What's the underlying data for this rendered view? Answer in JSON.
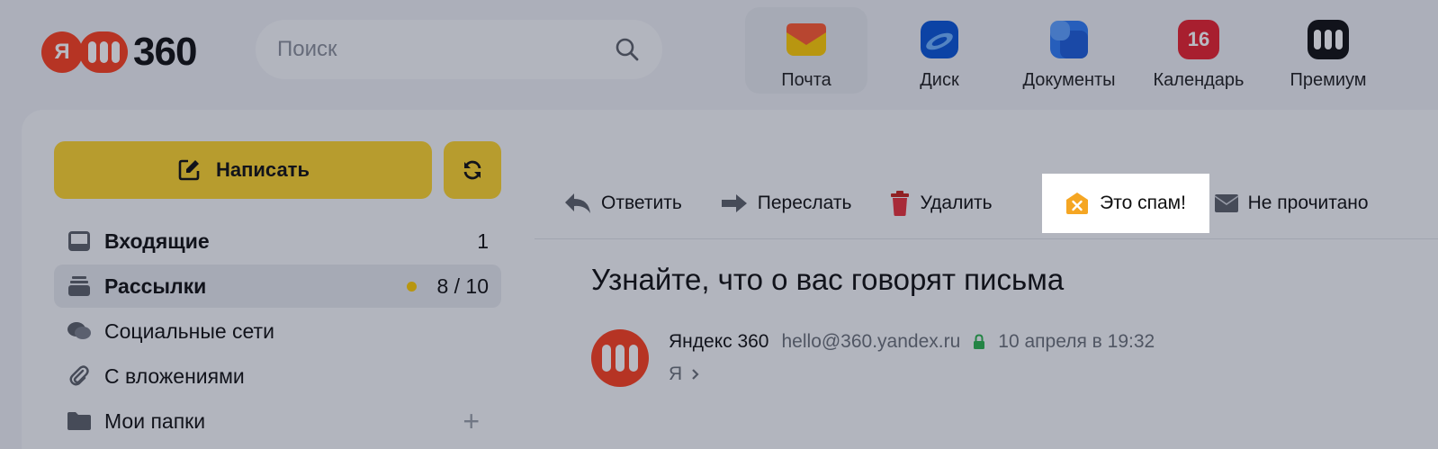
{
  "header": {
    "logo_ya": "Я",
    "logo_number": "360",
    "search_placeholder": "Поиск",
    "apps": [
      {
        "label": "Почта",
        "icon": "mail-icon"
      },
      {
        "label": "Диск",
        "icon": "disk-icon"
      },
      {
        "label": "Документы",
        "icon": "documents-icon"
      },
      {
        "label": "Календарь",
        "icon": "calendar-icon",
        "badge": "16"
      },
      {
        "label": "Премиум",
        "icon": "premium-icon"
      }
    ]
  },
  "sidebar": {
    "compose_label": "Написать",
    "folders": [
      {
        "name": "Входящие",
        "count": "1",
        "icon": "inbox-icon"
      },
      {
        "name": "Рассылки",
        "count": "8 / 10",
        "icon": "newsletter-icon"
      },
      {
        "name": "Социальные сети",
        "count": "",
        "icon": "social-icon"
      },
      {
        "name": "С вложениями",
        "count": "",
        "icon": "attachment-icon"
      },
      {
        "name": "Мои папки",
        "count": "",
        "icon": "folder-icon",
        "action": "+"
      }
    ]
  },
  "toolbar": {
    "reply": "Ответить",
    "forward": "Переслать",
    "delete": "Удалить",
    "spam": "Это спам!",
    "unread": "Не прочитано"
  },
  "message": {
    "subject": "Узнайте, что о вас говорят письма",
    "sender_name": "Яндекс 360",
    "sender_email": "hello@360.yandex.ru",
    "date": "10 апреля в 19:32",
    "recipient": "Я"
  },
  "colors": {
    "brand_red": "#fc3f1d",
    "compose_yellow": "#fed42b",
    "spam_orange": "#f5a623",
    "verified_green": "#2bb24c"
  }
}
